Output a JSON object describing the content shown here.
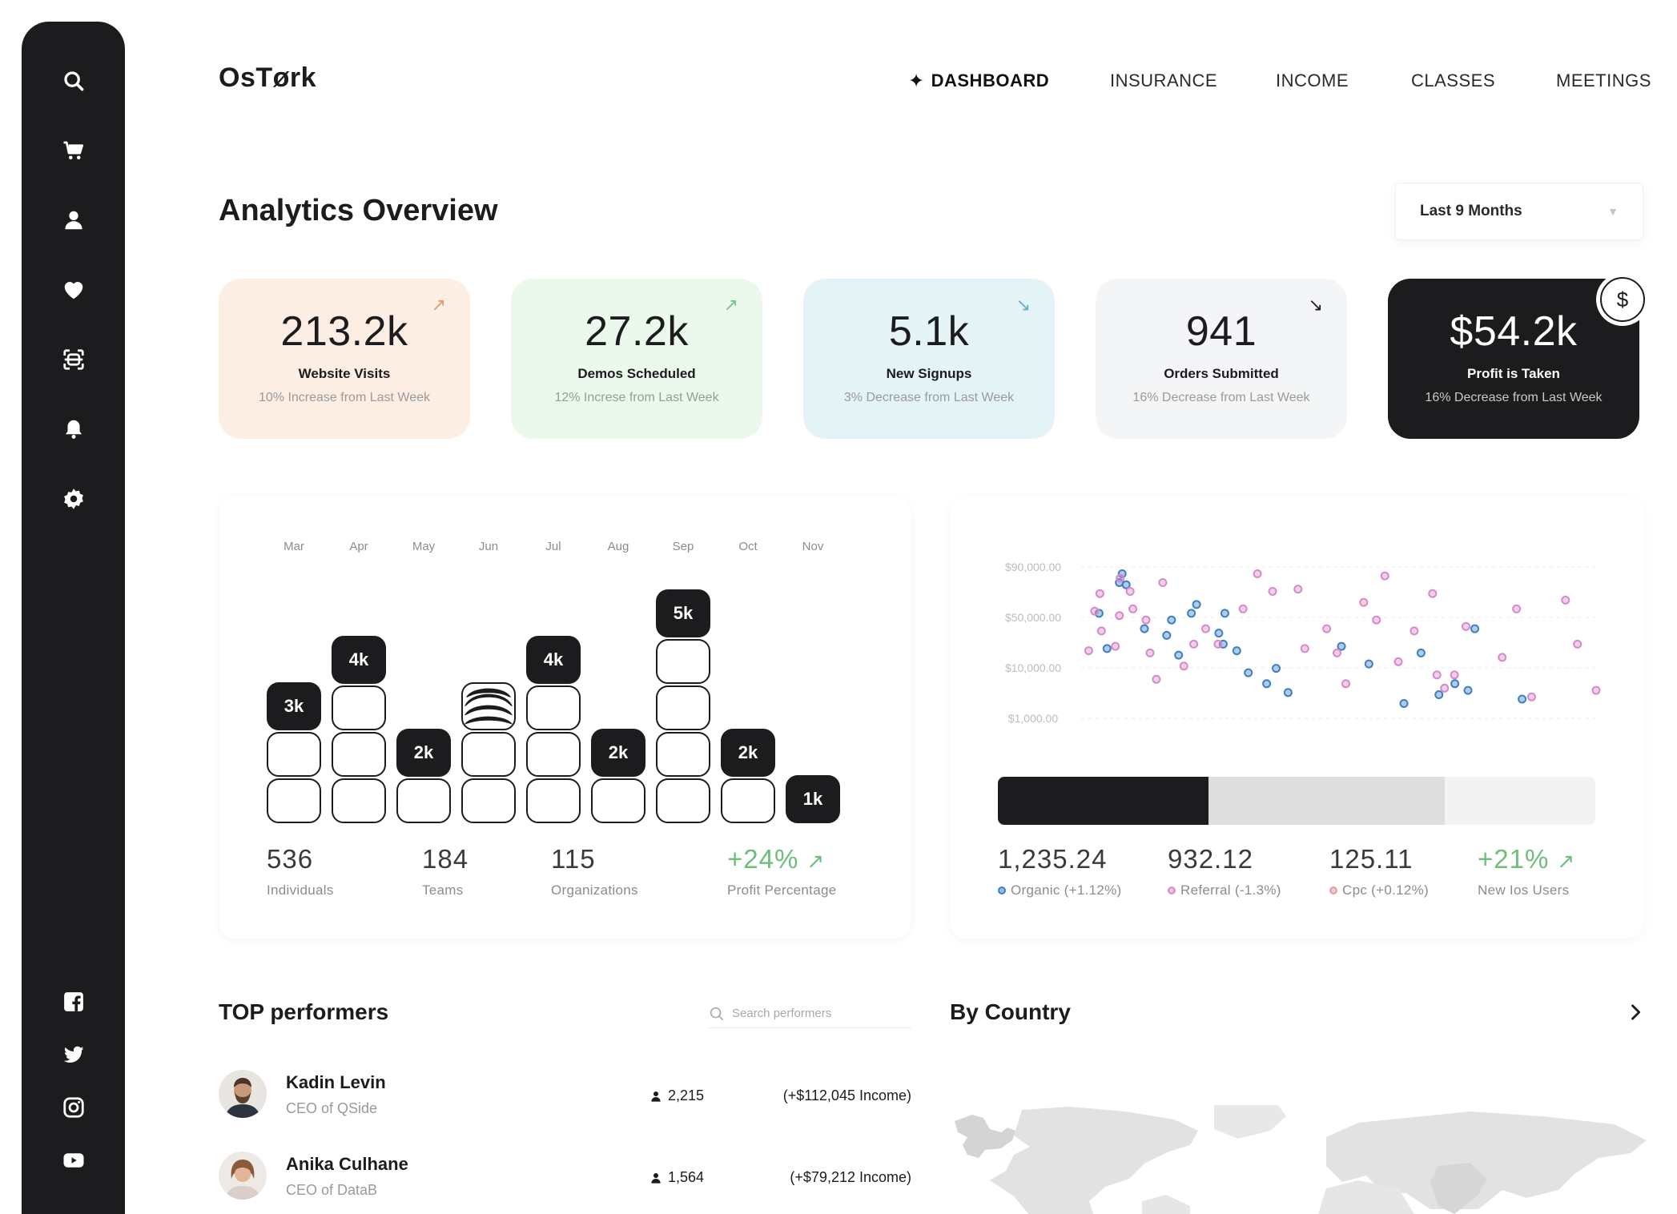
{
  "app": {
    "name": "OsTørk"
  },
  "nav": [
    {
      "label": "DASHBOARD",
      "active": true
    },
    {
      "label": "INSURANCE"
    },
    {
      "label": "INCOME"
    },
    {
      "label": "CLASSES"
    },
    {
      "label": "MEETINGS"
    }
  ],
  "sidebar": {
    "top_icons": [
      "search-icon",
      "cart-icon",
      "user-icon",
      "heart-icon",
      "scan-icon",
      "bell-icon",
      "gear-icon"
    ],
    "social_icons": [
      "facebook-icon",
      "twitter-icon",
      "instagram-icon",
      "youtube-icon"
    ]
  },
  "overview": {
    "title": "Analytics Overview",
    "period": "Last 9 Months"
  },
  "cards": [
    {
      "value": "213.2k",
      "label": "Website Visits",
      "sub": "10% Increase from Last Week",
      "trend": "up",
      "arrow": "↗",
      "bg": "#fdeee4",
      "arrow_color": "#e1996b"
    },
    {
      "value": "27.2k",
      "label": "Demos Scheduled",
      "sub": "12% Increse from Last Week",
      "trend": "up",
      "arrow": "↗",
      "bg": "#eaf9ec",
      "arrow_color": "#79c38a"
    },
    {
      "value": "5.1k",
      "label": "New Signups",
      "sub": "3% Decrease from Last Week",
      "trend": "down",
      "arrow": "↘",
      "bg": "#e4f3f6",
      "arrow_color": "#5fb1c4"
    },
    {
      "value": "941",
      "label": "Orders Submitted",
      "sub": "16% Decrease from Last Week",
      "trend": "down",
      "arrow": "↘",
      "bg": "#f3f5f7",
      "arrow_color": "#1c1c1e"
    },
    {
      "value": "$54.2k",
      "label": "Profit is Taken",
      "sub": "16% Decrease from Last Week",
      "trend": "down",
      "arrow": "",
      "bg": "#1c1c1e",
      "arrow_color": "#ffffff",
      "badge": "$"
    }
  ],
  "chart_data": [
    {
      "type": "bar",
      "categories": [
        "Mar",
        "Apr",
        "May",
        "Jun",
        "Jul",
        "Aug",
        "Sep",
        "Oct",
        "Nov"
      ],
      "values": [
        3,
        4,
        2,
        3,
        4,
        2,
        5,
        2,
        1
      ],
      "value_labels": [
        "3k",
        "4k",
        "2k",
        "",
        "4k",
        "2k",
        "5k",
        "2k",
        "1k"
      ],
      "unit": "k",
      "ylim": [
        0,
        5
      ]
    },
    {
      "type": "scatter",
      "y_ticks": [
        "$90,000.00",
        "$50,000.00",
        "$10,000.00",
        "$1,000.00"
      ],
      "grid": true,
      "colors": {
        "blue": "#3d7fc4",
        "pink": "#d88ac8"
      },
      "series": [
        {
          "points": [
            [
              6.5,
              3.5
            ],
            [
              4.5,
              5.1
            ],
            [
              10.3,
              6.9
            ],
            [
              9.6,
              6.5
            ],
            [
              11.3,
              6.4
            ],
            [
              15.9,
              4.4
            ],
            [
              22.7,
              4.8
            ],
            [
              21.5,
              4.1
            ],
            [
              24.5,
              3.2
            ],
            [
              27.7,
              5.1
            ],
            [
              29,
              5.5
            ],
            [
              34.6,
              4.2
            ],
            [
              36.1,
              5.1
            ],
            [
              35.7,
              3.7
            ],
            [
              39.1,
              3.4
            ],
            [
              42,
              2.4
            ],
            [
              46.6,
              1.9
            ],
            [
              49,
              2.6
            ],
            [
              52,
              1.5
            ],
            [
              65.4,
              3.6
            ],
            [
              72.3,
              2.8
            ],
            [
              81.1,
              1
            ],
            [
              85.4,
              3.3
            ],
            [
              89.9,
              1.4
            ],
            [
              93.9,
              1.9
            ],
            [
              97.2,
              1.6
            ],
            [
              98.9,
              4.4
            ],
            [
              110.8,
              1.2
            ]
          ],
          "color": "#3d7fc4"
        },
        {
          "points": [
            [
              1.9,
              3.4
            ],
            [
              3.4,
              5.2
            ],
            [
              5.1,
              4.3
            ],
            [
              4.7,
              6
            ],
            [
              9.6,
              5
            ],
            [
              8.6,
              3.6
            ],
            [
              9.8,
              6.7
            ],
            [
              12.3,
              6.1
            ],
            [
              13,
              5.3
            ],
            [
              16.3,
              4.8
            ],
            [
              17.3,
              3.3
            ],
            [
              18.9,
              2.1
            ],
            [
              20.5,
              6.5
            ],
            [
              25.8,
              2.7
            ],
            [
              28.3,
              3.7
            ],
            [
              31.3,
              4.4
            ],
            [
              34.4,
              3.7
            ],
            [
              40.7,
              5.3
            ],
            [
              44.3,
              6.9
            ],
            [
              48.1,
              6.1
            ],
            [
              54.5,
              6.2
            ],
            [
              56.2,
              3.5
            ],
            [
              61.7,
              4.4
            ],
            [
              64.3,
              3.3
            ],
            [
              66.5,
              1.9
            ],
            [
              71,
              5.6
            ],
            [
              74.2,
              4.8
            ],
            [
              76.3,
              6.8
            ],
            [
              79.7,
              2.9
            ],
            [
              83.7,
              4.3
            ],
            [
              88.3,
              6
            ],
            [
              89.4,
              2.3
            ],
            [
              91.3,
              1.7
            ],
            [
              93.8,
              2.3
            ],
            [
              96.7,
              4.5
            ],
            [
              105.8,
              3.1
            ],
            [
              109.4,
              5.3
            ],
            [
              113.2,
              1.3
            ],
            [
              121.7,
              5.7
            ],
            [
              124.7,
              3.7
            ],
            [
              129.4,
              1.6
            ]
          ],
          "color": "#d88ac8"
        }
      ]
    }
  ],
  "bar_stats": [
    {
      "value": "536",
      "label": "Individuals"
    },
    {
      "value": "184",
      "label": "Teams"
    },
    {
      "value": "115",
      "label": "Organizations"
    },
    {
      "value": "+24%",
      "label": "Profit Percentage",
      "arrow": "↗",
      "positive": true
    }
  ],
  "traffic": {
    "segments": [
      {
        "name": "Organic",
        "value": 1235.24,
        "color": "#1c1c1e"
      },
      {
        "name": "Referral",
        "value": 932.12,
        "color": "#dedede"
      },
      {
        "name": "Cpc",
        "value": 125.11,
        "color": "#f3f3f3"
      }
    ],
    "stats": [
      {
        "value": "1,235.24",
        "label": "Organic (+1.12%)",
        "dot": "#3d7fc4"
      },
      {
        "value": "932.12",
        "label": "Referral (-1.3%)",
        "dot": "#d88ac8"
      },
      {
        "value": "125.11",
        "label": "Cpc (+0.12%)",
        "dot": "#e79aa6"
      },
      {
        "value": "+21%",
        "label": "New Ios Users",
        "arrow": "↗",
        "positive": true
      }
    ]
  },
  "performers": {
    "title": "TOP performers",
    "search_placeholder": "Search performers",
    "items": [
      {
        "name": "Kadin Levin",
        "role": "CEO of QSide",
        "count": "2,215",
        "income": "(+$112,045 Income)"
      },
      {
        "name": "Anika Culhane",
        "role": "CEO of DataB",
        "count": "1,564",
        "income": "(+$79,212 Income)"
      }
    ]
  },
  "country": {
    "title": "By Country"
  },
  "colors": {
    "dark": "#1c1c1e",
    "positive": "#6dbf7b",
    "muted": "#8c8c8c"
  }
}
